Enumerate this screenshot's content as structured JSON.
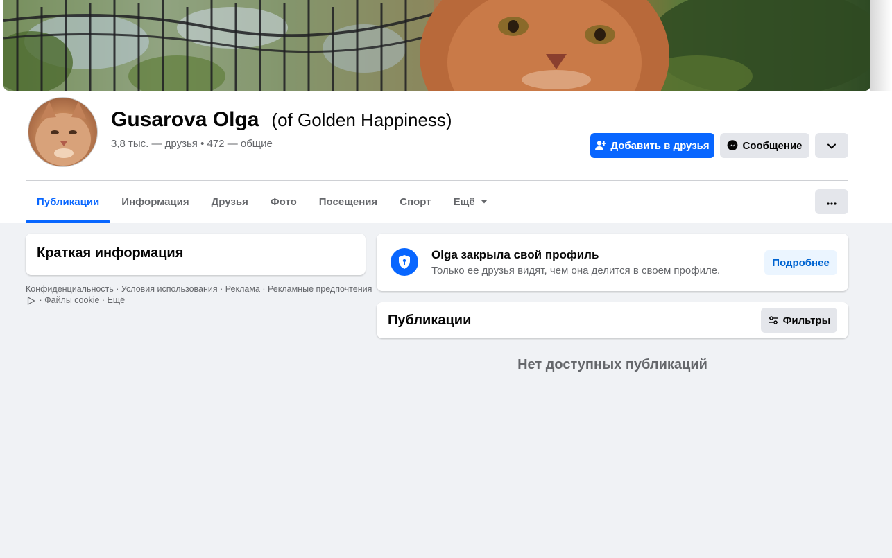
{
  "profile": {
    "name": "Gusarova Olga",
    "alternate_name": "(of Golden Happiness)",
    "friends_line": "3,8 тыс. — друзья • 472 — общие"
  },
  "actions": {
    "add_friend": "Добавить в друзья",
    "message": "Сообщение"
  },
  "tabs": [
    {
      "label": "Публикации",
      "active": true
    },
    {
      "label": "Информация"
    },
    {
      "label": "Друзья"
    },
    {
      "label": "Фото"
    },
    {
      "label": "Посещения"
    },
    {
      "label": "Спорт"
    },
    {
      "label": "Ещё"
    }
  ],
  "intro": {
    "title": "Краткая информация"
  },
  "footer": {
    "links": [
      "Конфиденциальность",
      "Условия использования",
      "Реклама",
      "Рекламные предпочтения",
      "Файлы cookie",
      "Ещё"
    ],
    "separator": " · "
  },
  "locked_profile": {
    "title": "Olga закрыла свой профиль",
    "subtitle": "Только ее друзья видят, чем она делится в своем профиле.",
    "button": "Подробнее"
  },
  "posts": {
    "title": "Публикации",
    "filters_button": "Фильтры",
    "empty_message": "Нет доступных публикаций"
  },
  "colors": {
    "primary": "#0866ff",
    "background": "#f0f2f5",
    "secondary_text": "#65676b",
    "button_gray": "#e4e6eb"
  }
}
